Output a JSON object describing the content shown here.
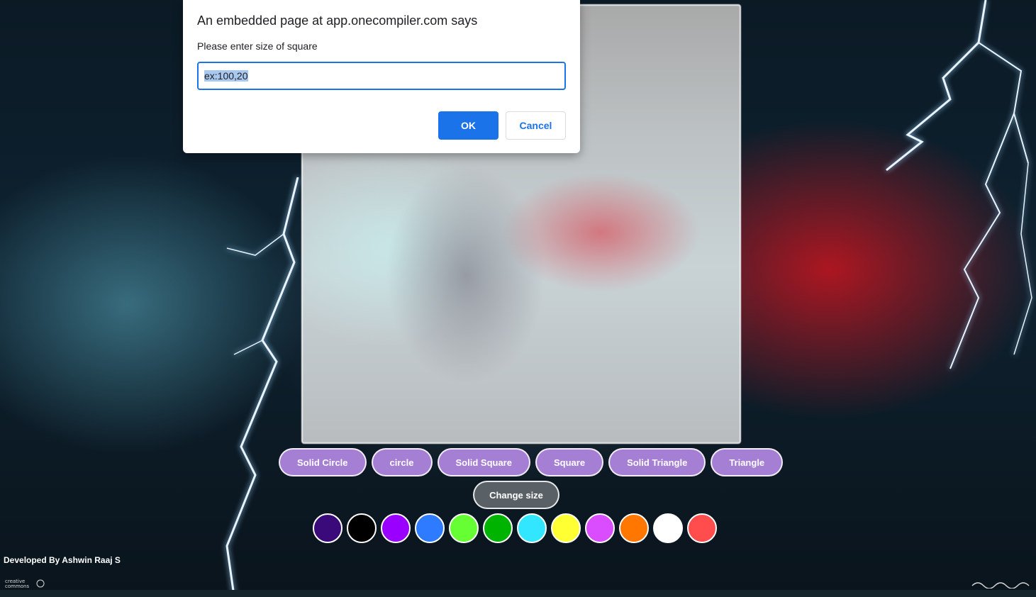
{
  "dialog": {
    "title": "An embedded page at app.onecompiler.com says",
    "message": "Please enter size of square",
    "input_value": "ex:100,20",
    "ok_label": "OK",
    "cancel_label": "Cancel"
  },
  "shape_buttons": [
    {
      "label": "Solid Circle"
    },
    {
      "label": "circle"
    },
    {
      "label": "Solid Square"
    },
    {
      "label": "Square"
    },
    {
      "label": "Solid Triangle"
    },
    {
      "label": "Triangle"
    }
  ],
  "change_size_label": "Change size",
  "swatches": [
    {
      "name": "indigo",
      "color": "#3a0a7a"
    },
    {
      "name": "black",
      "color": "#000000"
    },
    {
      "name": "violet",
      "color": "#9900ff"
    },
    {
      "name": "blue",
      "color": "#2f7bff"
    },
    {
      "name": "light-green",
      "color": "#66ff33"
    },
    {
      "name": "green",
      "color": "#00b300"
    },
    {
      "name": "cyan",
      "color": "#33e6ff"
    },
    {
      "name": "yellow",
      "color": "#ffff33"
    },
    {
      "name": "magenta",
      "color": "#d94dff"
    },
    {
      "name": "orange",
      "color": "#ff7700"
    },
    {
      "name": "white",
      "color": "#ffffff"
    },
    {
      "name": "red",
      "color": "#ff4d4d"
    }
  ],
  "footer": {
    "credit": "Developed By Ashwin Raaj S"
  }
}
